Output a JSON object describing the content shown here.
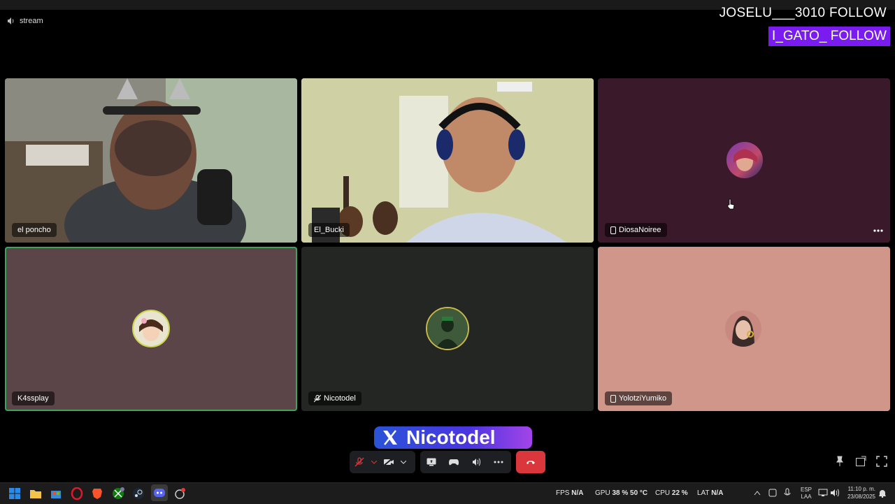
{
  "channel": {
    "name": "stream",
    "icon": "speaker-icon"
  },
  "overlay": {
    "follow1": "JOSELU___3010  FOLLOW",
    "follow2": "I_GATO_  FOLLOW"
  },
  "tiles": [
    {
      "name": "el poncho"
    },
    {
      "name": "El_Bucki"
    },
    {
      "name": "DiosaNoiree",
      "device": "mobile-icon"
    },
    {
      "name": "K4ssplay"
    },
    {
      "name": "Nicotodel",
      "muted": true
    },
    {
      "name": "YolotziYumiko",
      "device": "mobile-icon"
    }
  ],
  "brand": {
    "text": "Nicotodel",
    "icon": "x-logo-icon"
  },
  "controls": [
    "mic-muted-icon",
    "camera-off-icon",
    "share-screen-icon",
    "activity-icon",
    "soundboard-icon",
    "more-icon",
    "leave-call-icon"
  ],
  "taskbar": {
    "fps_label": "FPS",
    "fps_value": "N/A",
    "gpu_label": "GPU",
    "gpu_value": "38 %  50 °C",
    "cpu_label": "CPU",
    "cpu_value": "22 %",
    "lat_label": "LAT",
    "lat_value": "N/A",
    "lang1": "ESP",
    "lang2": "LAA",
    "time": "11:10 p. m.",
    "date": "23/08/2025"
  },
  "colors": {
    "leave": "#da373c",
    "speaking": "#3ba55d",
    "follow_bg": "#7a1cf0"
  }
}
